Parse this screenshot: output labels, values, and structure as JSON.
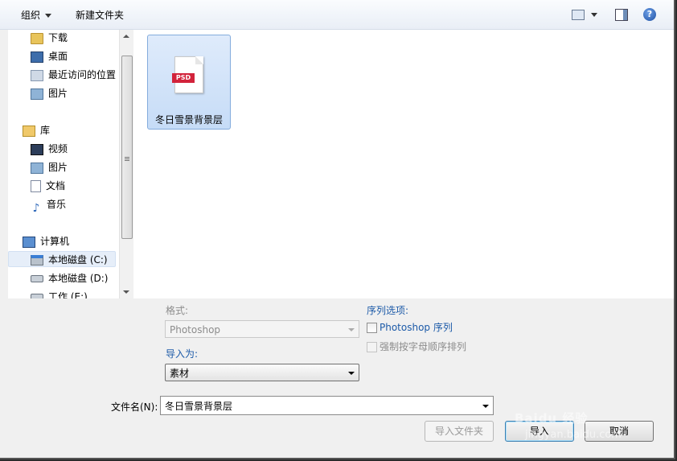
{
  "toolbar": {
    "organize_label": "组织",
    "new_folder_label": "新建文件夹"
  },
  "nav": {
    "items": [
      {
        "label": "下载",
        "icon": "downloads-folder-icon"
      },
      {
        "label": "桌面",
        "icon": "desktop-icon"
      },
      {
        "label": "最近访问的位置",
        "icon": "recent-places-icon"
      },
      {
        "label": "图片",
        "icon": "pictures-icon"
      },
      {
        "label": "库",
        "icon": "library-icon"
      },
      {
        "label": "视频",
        "icon": "video-icon"
      },
      {
        "label": "图片",
        "icon": "pictures-icon"
      },
      {
        "label": "文档",
        "icon": "document-icon"
      },
      {
        "label": "音乐",
        "icon": "music-icon"
      },
      {
        "label": "计算机",
        "icon": "computer-icon"
      },
      {
        "label": "本地磁盘 (C:)",
        "icon": "drive-c-icon"
      },
      {
        "label": "本地磁盘 (D:)",
        "icon": "drive-icon"
      },
      {
        "label": "工作 (E:)",
        "icon": "drive-icon"
      }
    ]
  },
  "files": [
    {
      "name": "冬日雪景背景层",
      "badge": "PSD"
    }
  ],
  "options": {
    "format_label": "格式:",
    "format_value": "Photoshop",
    "import_as_label": "导入为:",
    "import_as_value": "素材",
    "sequence_label": "序列选项:",
    "photoshop_sequence_label": "Photoshop 序列",
    "force_alpha_label": "强制按字母顺序排列"
  },
  "filename": {
    "label": "文件名(N):",
    "value": "冬日雪景背景层"
  },
  "buttons": {
    "import_folder": "导入文件夹",
    "import": "导入",
    "cancel": "取消"
  },
  "watermark": {
    "brand": "Baidu 经验",
    "url": "jingyan.baidu.com"
  }
}
